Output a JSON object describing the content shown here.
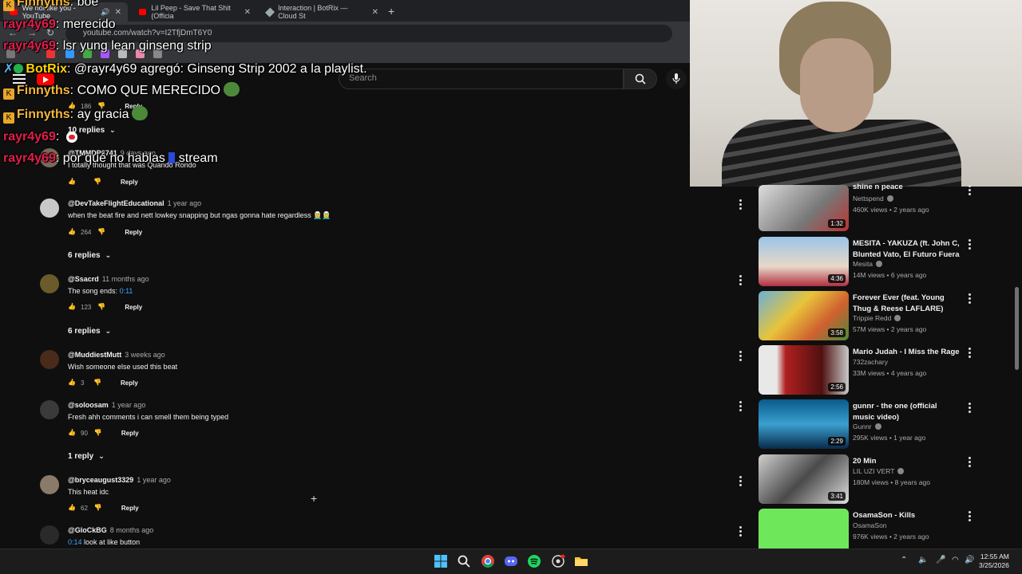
{
  "browser": {
    "tabs": [
      {
        "label": "We not like you - YouTube",
        "active": true
      },
      {
        "label": "Lil Peep - Save That Shit (Officia",
        "active": false
      },
      {
        "label": "Interaction | BotRix — Cloud St",
        "active": false
      }
    ],
    "new_tab": "+",
    "url": "youtube.com/watch?v=I2TfjDmT6Y0"
  },
  "youtube": {
    "search_placeholder": "Search"
  },
  "chat": {
    "lines": [
      {
        "user": "Finnyths",
        "text": "boe",
        "role": "finn"
      },
      {
        "user": "rayr4y69",
        "text": "merecido",
        "role": "rayr"
      },
      {
        "user": "rayr4y69",
        "text": "lsr yung lean ginseng strip",
        "role": "rayr"
      },
      {
        "user": "BotRix",
        "text": "@rayr4y69 agregó: Ginseng Strip 2002 a la playlist.",
        "role": "bot"
      },
      {
        "user": "Finnyths",
        "text": "COMO QUE MERECIDO",
        "role": "finn"
      },
      {
        "user": "Finnyths",
        "text": "ay gracia",
        "role": "finn"
      },
      {
        "user": "rayr4y69",
        "text": "",
        "role": "rayr"
      },
      {
        "user": "rayr4y69",
        "text": "por qué no hablas",
        "text2": "stream",
        "role": "rayr"
      }
    ]
  },
  "comments": {
    "top_partial": {
      "likes": "186",
      "reply": "Reply",
      "replies": "10 replies"
    },
    "items": [
      {
        "author": "@TMMDP6741",
        "time": "9 days ago",
        "text": "I totally thought that was Quando Rondo",
        "likes": "",
        "reply": "Reply"
      },
      {
        "author": "@DevTakeFlightEducational",
        "time": "1 year ago",
        "text": "when the beat fire and nett lowkey snapping but ngas gonna hate regardless 🧝‍♂️🧝‍♂️",
        "likes": "264",
        "reply": "Reply",
        "replies": "6 replies"
      },
      {
        "author": "@Ssacrd",
        "time": "11 months ago",
        "text": "The song ends:",
        "timestamp": "0:11",
        "likes": "123",
        "reply": "Reply",
        "replies": "6 replies"
      },
      {
        "author": "@MuddiestMutt",
        "time": "3 weeks ago",
        "text": "Wish someone else used this beat",
        "likes": "3",
        "reply": "Reply"
      },
      {
        "author": "@soloosam",
        "time": "1 year ago",
        "text": "Fresh ahh comments i can smell them being typed",
        "likes": "90",
        "reply": "Reply",
        "replies": "1 reply"
      },
      {
        "author": "@bryceaugust3329",
        "time": "1 year ago",
        "text": "This heat idc",
        "likes": "62",
        "reply": "Reply"
      },
      {
        "author": "@GloCkBG",
        "time": "8 months ago",
        "text": "look at like button",
        "timestamp": "0:14",
        "likes": "",
        "reply": ""
      }
    ]
  },
  "sidebar": {
    "videos": [
      {
        "title": "shine n peace",
        "channel": "Nettspend",
        "meta": "460K views • 2 years ago",
        "duration": "1:32"
      },
      {
        "title": "MESITA - YAKUZA (ft. John C, Blunted Vato, El Futuro Fuera ...",
        "channel": "Mesita",
        "meta": "14M views • 6 years ago",
        "duration": "4:36"
      },
      {
        "title": "Forever Ever (feat. Young Thug & Reese LAFLARE)",
        "channel": "Trippie Redd",
        "meta": "57M views • 2 years ago",
        "duration": "3:58"
      },
      {
        "title": "Mario Judah - I Miss the Rage",
        "channel": "732zachary",
        "meta": "33M views • 4 years ago",
        "duration": "2:56"
      },
      {
        "title": "gunnr - the one (official music video)",
        "channel": "Gunnr",
        "meta": "295K views • 1 year ago",
        "duration": "2:29"
      },
      {
        "title": "20 Min",
        "channel": "LIL UZI VERT",
        "meta": "180M views • 8 years ago",
        "duration": "3:41"
      },
      {
        "title": "OsamaSon - Kills",
        "channel": "OsamaSon",
        "meta": "976K views • 2 years ago",
        "duration": ""
      }
    ]
  },
  "taskbar": {
    "time": "12:55 AM",
    "date": "3/25/2026"
  }
}
